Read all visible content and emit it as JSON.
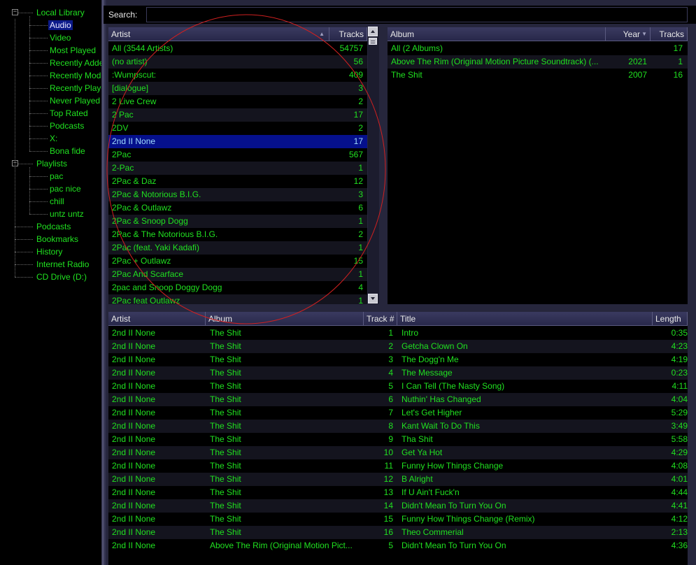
{
  "tree": {
    "local_library": "Local Library",
    "library_children": [
      "Audio",
      "Video",
      "Most Played",
      "Recently Added",
      "Recently Modified",
      "Recently Played",
      "Never Played",
      "Top Rated",
      "Podcasts",
      "X:",
      "Bona fide"
    ],
    "playlists": "Playlists",
    "playlist_children": [
      "pac",
      "pac nice",
      "chill",
      "untz untz"
    ],
    "other_roots": [
      "Podcasts",
      "Bookmarks",
      "History",
      "Internet Radio",
      "CD Drive (D:)"
    ],
    "selected": "Audio",
    "expander_glyph": "−"
  },
  "search": {
    "label": "Search:",
    "value": ""
  },
  "artist_pane": {
    "columns": {
      "artist": "Artist",
      "tracks": "Tracks"
    },
    "sort_indicator": "▲",
    "rows": [
      {
        "artist": "All (3544 Artists)",
        "tracks": "54757"
      },
      {
        "artist": "(no artist)",
        "tracks": "56"
      },
      {
        "artist": ":Wumpscut:",
        "tracks": "409"
      },
      {
        "artist": "[dialogue]",
        "tracks": "3"
      },
      {
        "artist": "2 Live Crew",
        "tracks": "2"
      },
      {
        "artist": "2 Pac",
        "tracks": "17"
      },
      {
        "artist": "2DV",
        "tracks": "2"
      },
      {
        "artist": "2nd II None",
        "tracks": "17"
      },
      {
        "artist": "2Pac",
        "tracks": "567"
      },
      {
        "artist": "2-Pac",
        "tracks": "1"
      },
      {
        "artist": "2Pac & Daz",
        "tracks": "12"
      },
      {
        "artist": "2Pac & Notorious B.I.G.",
        "tracks": "3"
      },
      {
        "artist": "2Pac & Outlawz",
        "tracks": "6"
      },
      {
        "artist": "2Pac & Snoop Dogg",
        "tracks": "1"
      },
      {
        "artist": "2Pac & The Notorious B.I.G.",
        "tracks": "2"
      },
      {
        "artist": "2Pac (feat. Yaki Kadafi)",
        "tracks": "1"
      },
      {
        "artist": "2Pac + Outlawz",
        "tracks": "15"
      },
      {
        "artist": "2Pac And Scarface",
        "tracks": "1"
      },
      {
        "artist": "2pac and Snoop Doggy Dogg",
        "tracks": "4"
      },
      {
        "artist": "2Pac feat Outlawz",
        "tracks": "1"
      }
    ],
    "selected_index": 7
  },
  "album_pane": {
    "columns": {
      "album": "Album",
      "year": "Year",
      "tracks": "Tracks"
    },
    "sort_indicator": "▼",
    "rows": [
      {
        "album": "All (2 Albums)",
        "year": "",
        "tracks": "17"
      },
      {
        "album": "Above The Rim (Original Motion Picture Soundtrack) (...",
        "year": "2021",
        "tracks": "1"
      },
      {
        "album": "The Shit",
        "year": "2007",
        "tracks": "16"
      }
    ]
  },
  "tracks_pane": {
    "columns": {
      "artist": "Artist",
      "album": "Album",
      "track": "Track #",
      "title": "Title",
      "length": "Length"
    },
    "rows": [
      {
        "artist": "2nd II None",
        "album": "The Shit",
        "track": "1",
        "title": "Intro",
        "length": "0:35"
      },
      {
        "artist": "2nd II None",
        "album": "The Shit",
        "track": "2",
        "title": "Getcha Clown On",
        "length": "4:23"
      },
      {
        "artist": "2nd II None",
        "album": "The Shit",
        "track": "3",
        "title": "The Dogg'n Me",
        "length": "4:19"
      },
      {
        "artist": "2nd II None",
        "album": "The Shit",
        "track": "4",
        "title": "The Message",
        "length": "0:23"
      },
      {
        "artist": "2nd II None",
        "album": "The Shit",
        "track": "5",
        "title": "I Can Tell (The Nasty Song)",
        "length": "4:11"
      },
      {
        "artist": "2nd II None",
        "album": "The Shit",
        "track": "6",
        "title": "Nuthin' Has Changed",
        "length": "4:04"
      },
      {
        "artist": "2nd II None",
        "album": "The Shit",
        "track": "7",
        "title": "Let's Get Higher",
        "length": "5:29"
      },
      {
        "artist": "2nd II None",
        "album": "The Shit",
        "track": "8",
        "title": "Kant Wait To Do This",
        "length": "3:49"
      },
      {
        "artist": "2nd II None",
        "album": "The Shit",
        "track": "9",
        "title": "Tha Shit",
        "length": "5:58"
      },
      {
        "artist": "2nd II None",
        "album": "The Shit",
        "track": "10",
        "title": "Get Ya Hot",
        "length": "4:29"
      },
      {
        "artist": "2nd II None",
        "album": "The Shit",
        "track": "11",
        "title": "Funny How Things Change",
        "length": "4:08"
      },
      {
        "artist": "2nd II None",
        "album": "The Shit",
        "track": "12",
        "title": "B Alright",
        "length": "4:01"
      },
      {
        "artist": "2nd II None",
        "album": "The Shit",
        "track": "13",
        "title": "If U Ain't Fuck'n",
        "length": "4:44"
      },
      {
        "artist": "2nd II None",
        "album": "The Shit",
        "track": "14",
        "title": "Didn't Mean To Turn You On",
        "length": "4:41"
      },
      {
        "artist": "2nd II None",
        "album": "The Shit",
        "track": "15",
        "title": "Funny How Things Change (Remix)",
        "length": "4:12"
      },
      {
        "artist": "2nd II None",
        "album": "The Shit",
        "track": "16",
        "title": "Theo Commerial",
        "length": "2:13"
      },
      {
        "artist": "2nd II None",
        "album": "Above The Rim (Original Motion Pict...",
        "track": "5",
        "title": "Didn't Mean To Turn You On",
        "length": "4:36"
      }
    ]
  },
  "colors": {
    "text": "#20e020",
    "selection": "#05108c",
    "header": "#3a3a60",
    "annotation": "#d02020"
  },
  "icons": {
    "scroll_up": "scroll-up-arrow-icon",
    "scroll_down": "scroll-down-arrow-icon"
  }
}
